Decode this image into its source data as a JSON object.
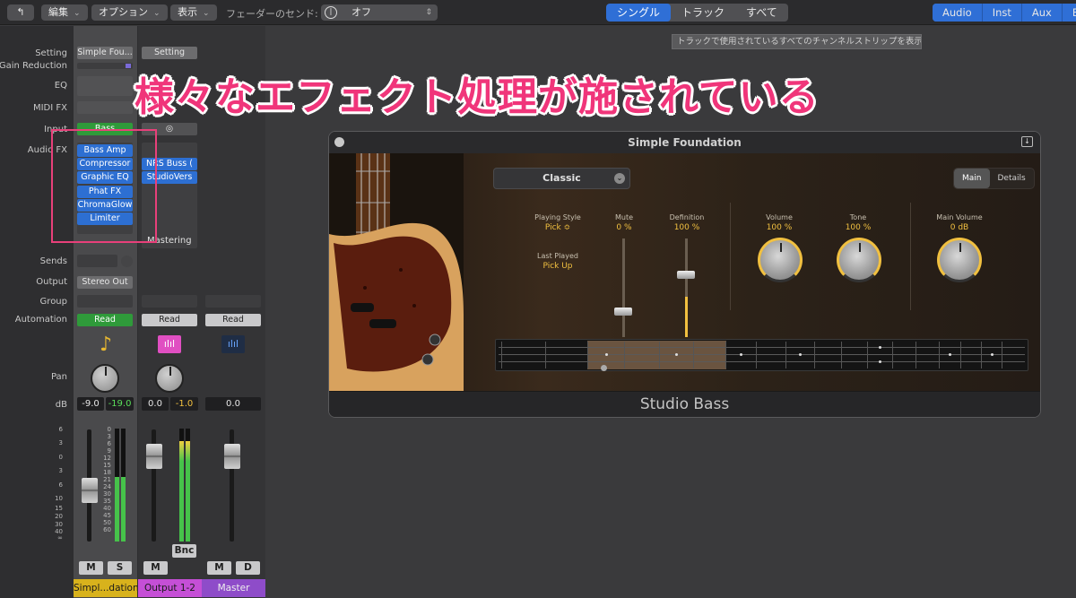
{
  "toolbar": {
    "edit": "編集",
    "options": "オプション",
    "view": "表示",
    "fader_send_label": "フェーダーのセンド:",
    "fader_send_value": "オフ",
    "view_modes": [
      "シングル",
      "トラック",
      "すべて"
    ],
    "active_view_mode": "シングル",
    "filters": [
      "Audio",
      "Inst",
      "Aux",
      "B"
    ]
  },
  "tooltip": "トラックで使用されているすべてのチャンネルストリップを表示",
  "headline": "様々なエフェクト処理が施されている",
  "labels": {
    "setting": "Setting",
    "gain_reduction": "Gain Reduction",
    "eq": "EQ",
    "midi_fx": "MIDI FX",
    "input": "Input",
    "audio_fx": "Audio FX",
    "sends": "Sends",
    "output": "Output",
    "group": "Group",
    "automation": "Automation",
    "pan": "Pan",
    "db": "dB"
  },
  "strips": [
    {
      "setting": "Simple Fou...",
      "input": "Bass",
      "audio_fx": [
        "Bass Amp",
        "Compressor",
        "Graphic EQ",
        "Phat FX",
        "ChromaGlow",
        "Limiter"
      ],
      "output": "Stereo Out",
      "automation": "Read",
      "vol": "-9.0",
      "peak": "-19.0",
      "scale": [
        "6",
        "3",
        "0",
        "3",
        "6",
        "10",
        "15",
        "20",
        "30",
        "40",
        "∞"
      ],
      "meter_scale": [
        "0",
        "3",
        "6",
        "9",
        "12",
        "15",
        "18",
        "21",
        "24",
        "30",
        "35",
        "40",
        "45",
        "50",
        "60"
      ],
      "buttons": [
        "M",
        "S"
      ],
      "name": "Simpl...dation",
      "color": "#d8b21c"
    },
    {
      "setting": "Setting",
      "audio_fx": [
        "NRS Buss (",
        "StudioVers"
      ],
      "audio_fx_footer": "Mastering",
      "automation": "Read",
      "vol": "0.0",
      "peak": "-1.0",
      "bnc": "Bnc",
      "buttons": [
        "M"
      ],
      "name": "Output 1-2",
      "color": "#c54fd6"
    },
    {
      "automation": "Read",
      "vol": "0.0",
      "buttons": [
        "M",
        "D"
      ],
      "name": "Master",
      "color": "#8e4cc9"
    }
  ],
  "plugin": {
    "title": "Simple Foundation",
    "preset": "Classic",
    "tabs": [
      "Main",
      "Details"
    ],
    "active_tab": "Main",
    "playing_style_label": "Playing Style",
    "playing_style_value": "Pick ≎",
    "last_played_label": "Last Played",
    "last_played_value": "Pick Up",
    "mute_label": "Mute",
    "mute_value": "0 %",
    "definition_label": "Definition",
    "definition_value": "100 %",
    "volume_label": "Volume",
    "volume_value": "100 %",
    "tone_label": "Tone",
    "tone_value": "100 %",
    "main_volume_label": "Main Volume",
    "main_volume_value": "0 dB",
    "footer": "Studio Bass"
  },
  "colors": {
    "accent_blue": "#2f6fd6",
    "highlight": "#e8407a",
    "gold": "#f1c040"
  }
}
